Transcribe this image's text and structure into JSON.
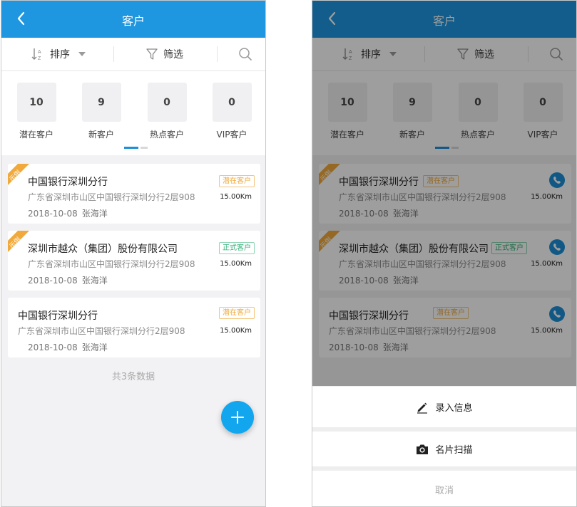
{
  "screens": [
    {
      "header": {
        "title": "客户"
      },
      "toolbar": {
        "sort_label": "排序",
        "filter_label": "筛选"
      },
      "stats": [
        {
          "value": "10",
          "label": "潜在客户"
        },
        {
          "value": "9",
          "label": "新客户"
        },
        {
          "value": "0",
          "label": "热点客户"
        },
        {
          "value": "0",
          "label": "VIP客户"
        }
      ],
      "customers": [
        {
          "ribbon": "示例",
          "name": "中国银行深圳分行",
          "badge": "潜在客户",
          "address": "广东省深圳市山区中国银行深圳分行2层908",
          "date": "2018-10-08",
          "person": "张海洋",
          "distance": "15.00Km"
        },
        {
          "ribbon": "示例",
          "name": "深圳市越众（集团）股份有限公司",
          "badge": "正式客户",
          "address": "广东省深圳市山区中国银行深圳分行2层908",
          "date": "2018-10-08",
          "person": "张海洋",
          "distance": "15.00Km"
        },
        {
          "ribbon": "",
          "name": "中国银行深圳分行",
          "badge": "潜在客户",
          "address": "广东省深圳市山区中国银行深圳分行2层908",
          "date": "2018-10-08",
          "person": "张海洋",
          "distance": "15.00Km"
        }
      ],
      "footer_count": "共3条数据"
    },
    {
      "header": {
        "title": "客户"
      },
      "toolbar": {
        "sort_label": "排序",
        "filter_label": "筛选"
      },
      "stats": [
        {
          "value": "10",
          "label": "潜在客户"
        },
        {
          "value": "9",
          "label": "新客户"
        },
        {
          "value": "0",
          "label": "热点客户"
        },
        {
          "value": "0",
          "label": "VIP客户"
        }
      ],
      "customers": [
        {
          "ribbon": "示例",
          "name": "中国银行深圳分行",
          "badge": "潜在客户",
          "address": "广东省深圳市山区中国银行深圳分行2层908",
          "date": "2018-10-08",
          "person": "张海洋",
          "distance": "15.00Km"
        },
        {
          "ribbon": "示例",
          "name": "深圳市越众（集团）股份有限公司",
          "badge": "正式客户",
          "address": "广东省深圳市山区中国银行深圳分行2层908",
          "date": "2018-10-08",
          "person": "张海洋",
          "distance": "15.00Km"
        },
        {
          "ribbon": "",
          "name": "中国银行深圳分行",
          "badge": "潜在客户",
          "address": "广东省深圳市山区中国银行深圳分行2层908",
          "date": "2018-10-08",
          "person": "张海洋",
          "distance": "15.00Km"
        }
      ],
      "action_sheet": {
        "enter_info": "录入信息",
        "card_scan": "名片扫描",
        "cancel": "取消"
      }
    }
  ],
  "colors": {
    "header": "#1e97e0",
    "fab": "#12a6ee",
    "potential_badge": "#f0a93a",
    "formal_badge": "#36b07a",
    "ribbon": "#f0a93a",
    "phone_button": "#1e8fd7"
  },
  "icons": [
    "back-chevron-icon",
    "sort-az-icon",
    "caret-down-icon",
    "filter-funnel-icon",
    "search-icon",
    "plus-icon",
    "phone-icon",
    "pencil-icon",
    "camera-icon"
  ]
}
